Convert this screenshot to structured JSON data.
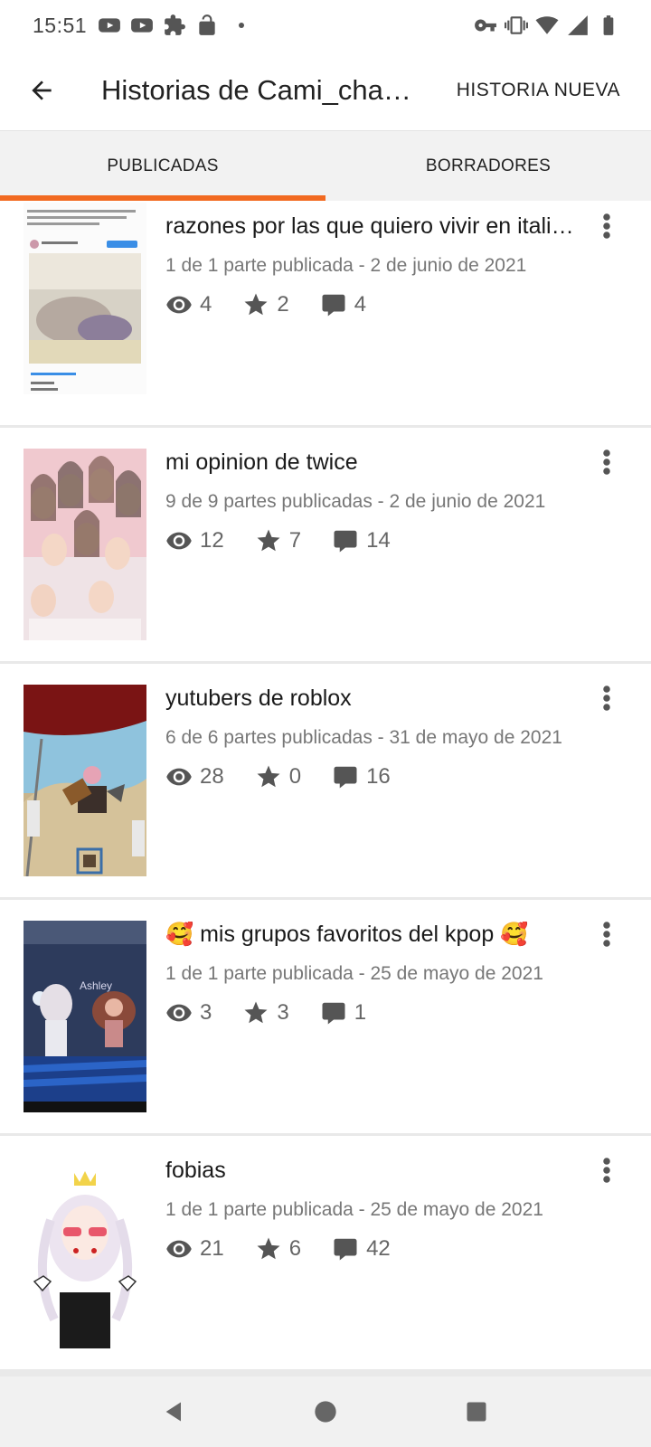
{
  "status_bar": {
    "time": "15:51",
    "left_icons": [
      "youtube-icon",
      "youtube-icon",
      "puzzle-icon",
      "lock-open-icon"
    ],
    "right_icons": [
      "key-icon",
      "vibrate-icon",
      "wifi-icon",
      "signal-icon",
      "battery-icon"
    ]
  },
  "app_bar": {
    "title": "Historias de Cami_cha…",
    "new_story_label": "HISTORIA NUEVA"
  },
  "tabs": [
    {
      "label": "PUBLICADAS",
      "active": true
    },
    {
      "label": "BORRADORES",
      "active": false
    }
  ],
  "accent_color": "#f26a21",
  "stories": [
    {
      "title": "razones por las que quiero vivir en itali…",
      "meta": "1 de 1 parte publicada - 2 de junio de 2021",
      "views": "4",
      "votes": "2",
      "comments": "4"
    },
    {
      "title": "mi opinion de twice",
      "meta": "9 de 9 partes publicadas - 2 de junio de 2021",
      "views": "12",
      "votes": "7",
      "comments": "14"
    },
    {
      "title": "yutubers de roblox",
      "meta": "6 de 6 partes publicadas - 31 de mayo de 2021",
      "views": "28",
      "votes": "0",
      "comments": "16"
    },
    {
      "title": "🥰 mis grupos favoritos del kpop 🥰",
      "meta": "1 de 1 parte publicada - 25 de mayo de 2021",
      "views": "3",
      "votes": "3",
      "comments": "1"
    },
    {
      "title": "fobias",
      "meta": "1 de 1 parte publicada - 25 de mayo de 2021",
      "views": "21",
      "votes": "6",
      "comments": "42"
    }
  ],
  "nav_bar": [
    "back-triangle-icon",
    "home-circle-icon",
    "recents-square-icon"
  ]
}
